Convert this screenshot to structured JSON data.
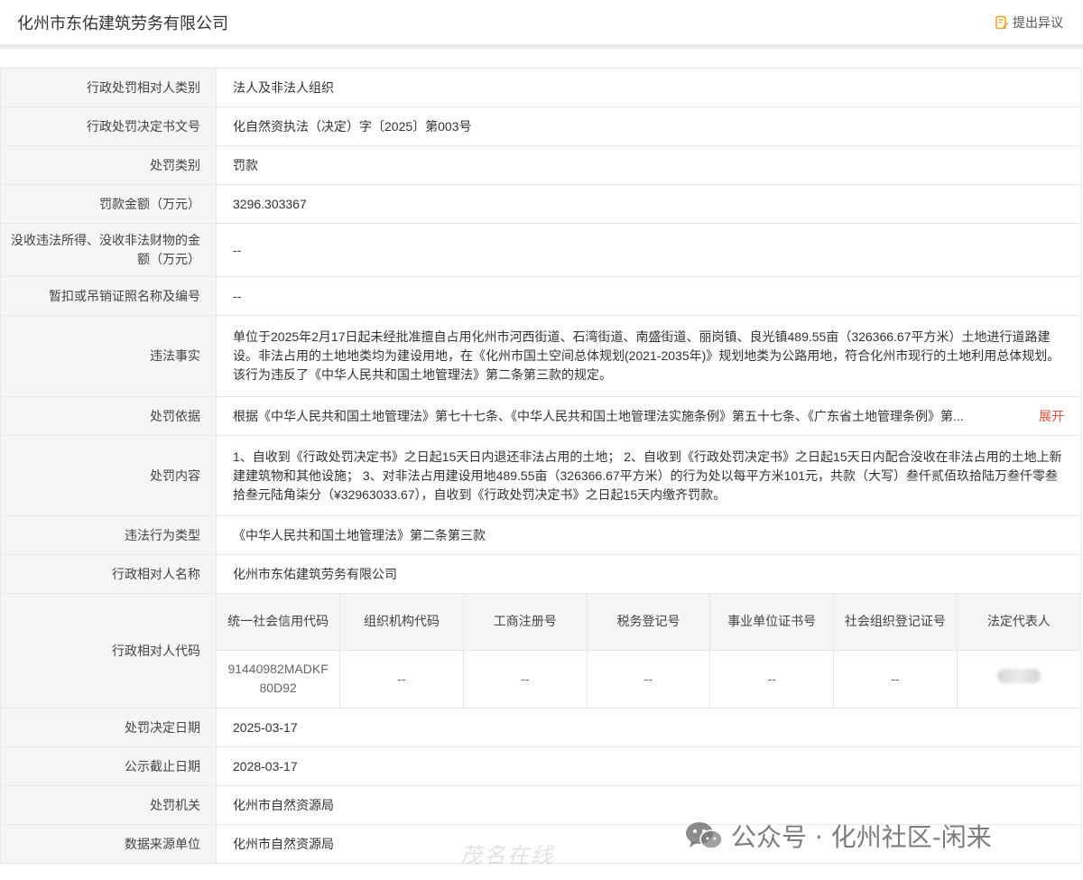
{
  "header": {
    "company_title": "化州市东佑建筑劳务有限公司",
    "objection_label": "提出异议"
  },
  "rows": {
    "party_type": {
      "label": "行政处罚相对人类别",
      "value": "法人及非法人组织"
    },
    "decision_no": {
      "label": "行政处罚决定书文号",
      "value": "化自然资执法（决定）字〔2025〕第003号"
    },
    "penalty_type": {
      "label": "处罚类别",
      "value": "罚款"
    },
    "fine_amount": {
      "label": "罚款金额（万元）",
      "value": "3296.303367"
    },
    "confiscation": {
      "label": "没收违法所得、没收非法财物的金额（万元）",
      "value": "--"
    },
    "license": {
      "label": "暂扣或吊销证照名称及编号",
      "value": "--"
    },
    "facts": {
      "label": "违法事实",
      "value": "单位于2025年2月17日起未经批准擅自占用化州市河西街道、石湾街道、南盛街道、丽岗镇、良光镇489.55亩（326366.67平方米）土地进行道路建设。非法占用的土地地类均为建设用地，在《化州市国土空间总体规划(2021-2035年)》规划地类为公路用地，符合化州市现行的土地利用总体规划。该行为违反了《中华人民共和国土地管理法》第二条第三款的规定。"
    },
    "basis": {
      "label": "处罚依据",
      "value": "根据《中华人民共和国土地管理法》第七十七条、《中华人民共和国土地管理法实施条例》第五十七条、《广东省土地管理条例》第...",
      "expand_label": "展开"
    },
    "content": {
      "label": "处罚内容",
      "value": "1、自收到《行政处罚决定书》之日起15天日内退还非法占用的土地；  2、自收到《行政处罚决定书》之日起15天日内配合没收在非法占用的土地上新建建筑物和其他设施；  3、对非法占用建设用地489.55亩（326366.67平方米）的行为处以每平方米101元，共款（大写）叁仟贰佰玖拾陆万叁仟零叁拾叁元陆角柒分（¥32963033.67），自收到《行政处罚决定书》之日起15天内缴齐罚款。"
    },
    "violation_type": {
      "label": "违法行为类型",
      "value": "《中华人民共和国土地管理法》第二条第三款"
    },
    "party_name": {
      "label": "行政相对人名称",
      "value": "化州市东佑建筑劳务有限公司"
    },
    "party_code": {
      "label": "行政相对人代码",
      "headers": [
        "统一社会信用代码",
        "组织机构代码",
        "工商注册号",
        "税务登记号",
        "事业单位证书号",
        "社会组织登记证号",
        "法定代表人"
      ],
      "values": [
        "91440982MADKF80D92",
        "--",
        "--",
        "--",
        "--",
        "--",
        ""
      ]
    },
    "decision_date": {
      "label": "处罚决定日期",
      "value": "2025-03-17"
    },
    "publicity_end": {
      "label": "公示截止日期",
      "value": "2028-03-17"
    },
    "authority": {
      "label": "处罚机关",
      "value": "化州市自然资源局"
    },
    "source_unit": {
      "label": "数据来源单位",
      "value": "化州市自然资源局"
    }
  },
  "watermark": {
    "text": "公众号 · 化州社区-闲来",
    "site": "茂名在线"
  },
  "colors": {
    "label_bg": "#f5f5f5",
    "border": "#e8e8e8",
    "expand": "#e24b34",
    "objection_icon": "#f0a020"
  }
}
